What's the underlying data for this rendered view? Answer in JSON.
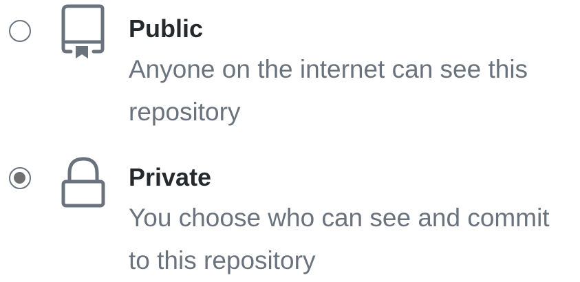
{
  "visibility": {
    "options": [
      {
        "title": "Public",
        "description_lines": [
          "Anyone on the internet can see this",
          "repository"
        ],
        "icon": "repo-icon",
        "selected": false
      },
      {
        "title": "Private",
        "description_lines": [
          "You choose who can see and commit",
          "to this repository"
        ],
        "icon": "lock-icon",
        "selected": true
      }
    ]
  },
  "colors": {
    "title": "#24292e",
    "description": "#6a737d",
    "icon_stroke": "#6a737d",
    "radio_dot": "#707070"
  }
}
